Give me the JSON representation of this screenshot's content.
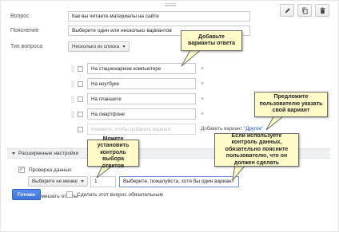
{
  "toolbar": {
    "edit_icon": "pencil-icon",
    "copy_icon": "duplicate-icon",
    "delete_icon": "trash-icon"
  },
  "form": {
    "question_label": "Вопрос",
    "question_value": "Как вы читаете материалы на сайте",
    "hint_label": "Пояснение",
    "hint_value": "Выберите один или несколько вариантов",
    "type_label": "Тип вопроса",
    "type_value": "Несколько из списка"
  },
  "options": [
    {
      "label": "На стационарном компьютере"
    },
    {
      "label": "На ноутбуке"
    },
    {
      "label": "На планшете"
    },
    {
      "label": "На смартфоне"
    }
  ],
  "add_option": {
    "placeholder": "Нажмите, чтобы добавить вариант",
    "add_other_prefix": "Добавить вариант ",
    "add_other_link": "\"Другое\""
  },
  "advanced": {
    "header": "Расширенные настройки",
    "validation_label": "Проверка данных",
    "validation_type": "Выберите не менее",
    "validation_number": "1",
    "validation_message": "Выберите, пожалуйста, хотя бы один вариант",
    "shuffle_label": "Перемешать ответы"
  },
  "footer": {
    "done_label": "Готово",
    "required_label": "Сделать этот вопрос обязательным"
  },
  "callouts": {
    "add_variants": "Добавьте варианты ответа",
    "other_option": "Предложите пользователю указать свой вариант",
    "min_control": "Можете установить контроль выбора ответов",
    "explain_control": "Если используете контроль данных, обязательно поясните пользователю, что он должен сделать"
  },
  "colors": {
    "accent": "#3a74e0",
    "callout_bg": "#fffbc8",
    "link": "#1155cc"
  }
}
